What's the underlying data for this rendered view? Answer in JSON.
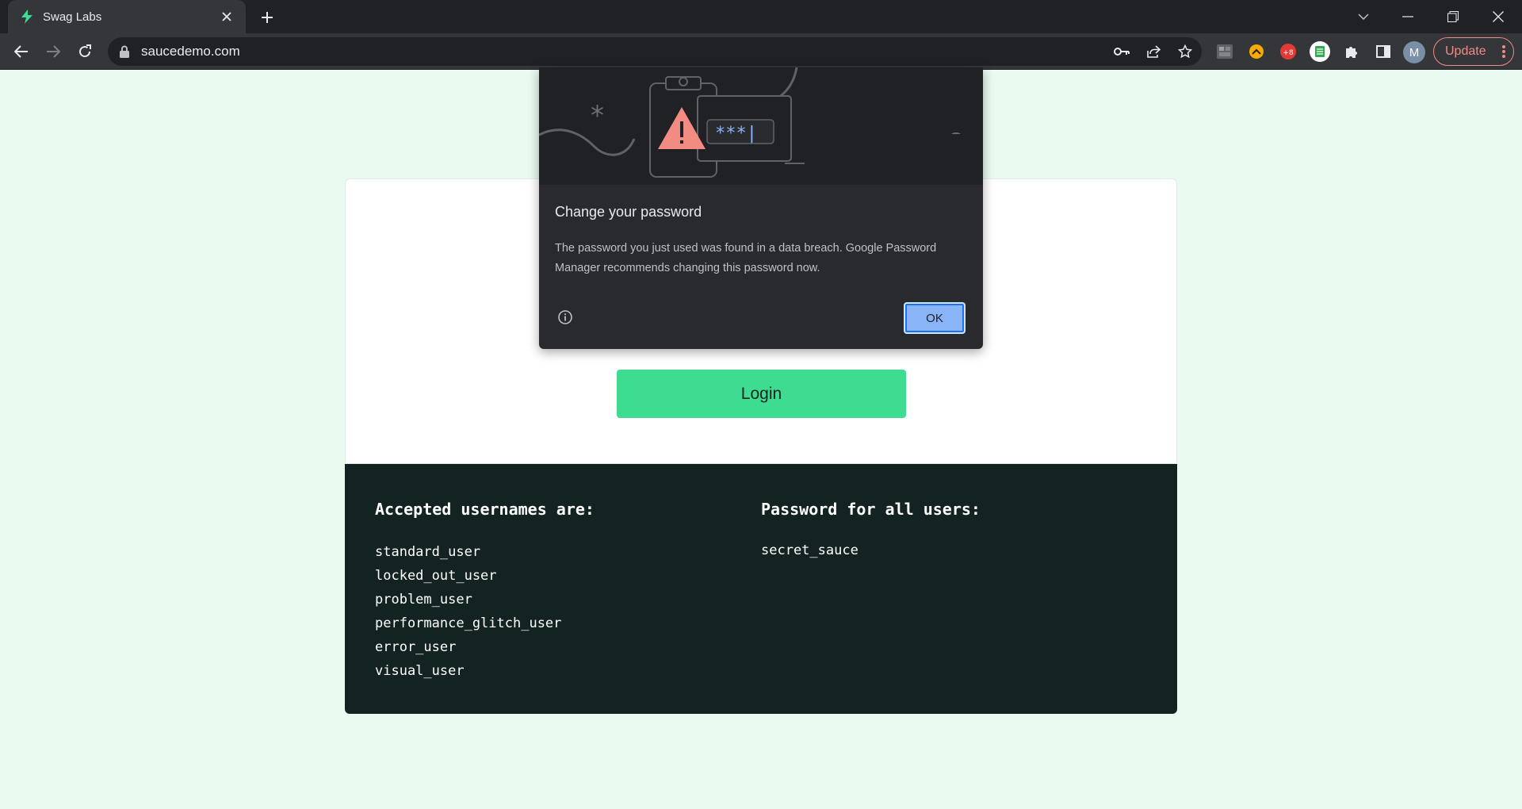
{
  "browser": {
    "tab": {
      "title": "Swag Labs",
      "favicon": "swag-labs-logo"
    },
    "url": "saucedemo.com",
    "update_label": "Update",
    "avatar_letter": "M"
  },
  "page": {
    "login_button": "Login",
    "credentials": {
      "usernames_heading": "Accepted usernames are:",
      "usernames": [
        "standard_user",
        "locked_out_user",
        "problem_user",
        "performance_glitch_user",
        "error_user",
        "visual_user"
      ],
      "password_heading": "Password for all users:",
      "password": "secret_sauce"
    }
  },
  "popup": {
    "title": "Change your password",
    "body": "The password you just used was found in a data breach. Google Password Manager recommends changing this password now.",
    "ok_label": "OK",
    "illustration_text": "***|"
  },
  "colors": {
    "page_bg": "#eafaf1",
    "login_button": "#3ddc91",
    "credentials_bg": "#132322",
    "popup_bg": "#292a2d",
    "ok_button": "#8ab4f8",
    "warning": "#f28b82"
  }
}
